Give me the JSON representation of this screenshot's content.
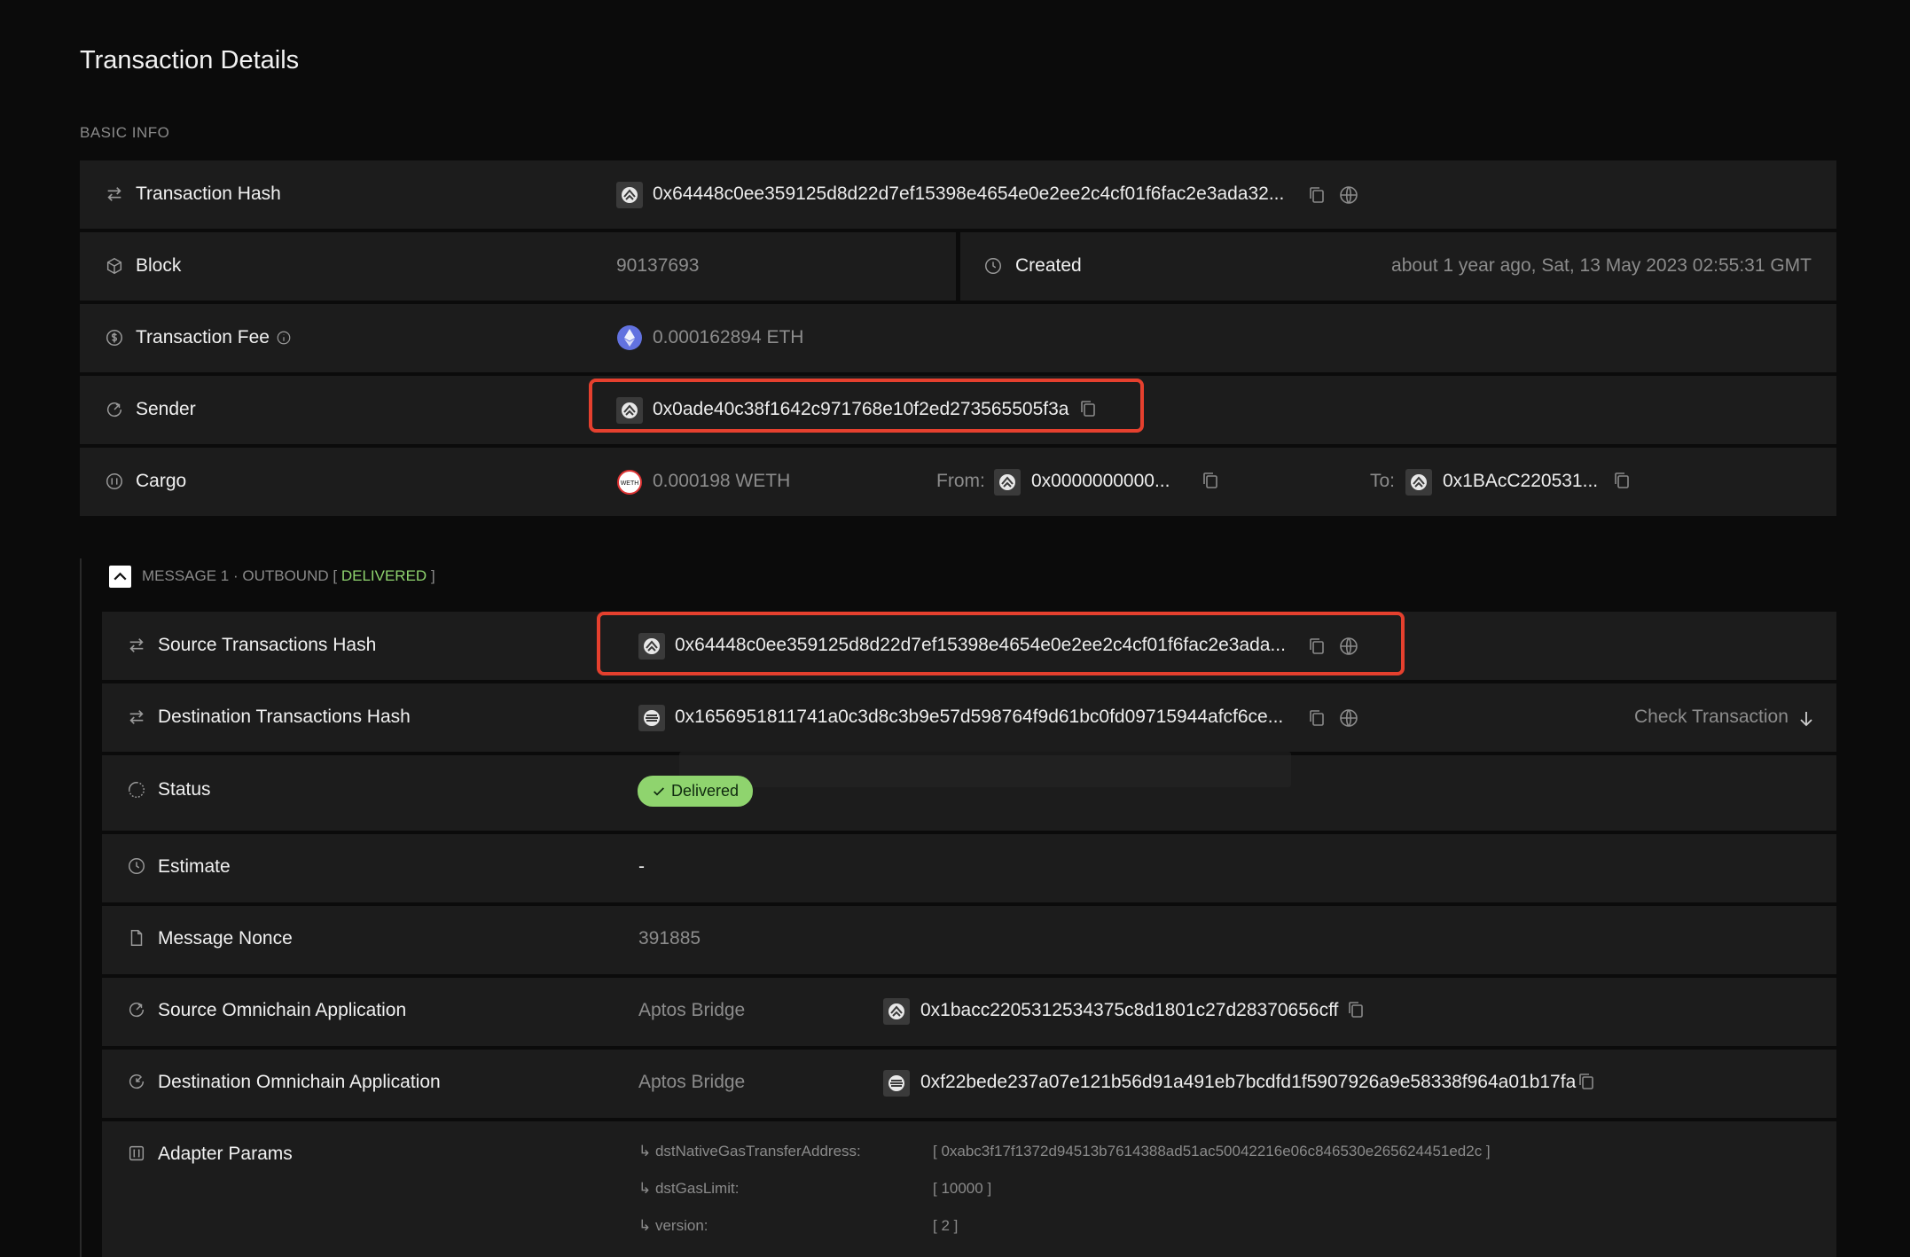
{
  "page_title": "Transaction Details",
  "section_basic": "BASIC INFO",
  "basic": {
    "tx_hash": {
      "label": "Transaction Hash",
      "value": "0x64448c0ee359125d8d22d7ef15398e4654e0e2ee2c4cf01f6fac2e3ada32..."
    },
    "block": {
      "label": "Block",
      "value": "90137693"
    },
    "created": {
      "label": "Created",
      "value": "about 1 year ago, Sat, 13 May 2023 02:55:31 GMT"
    },
    "fee": {
      "label": "Transaction Fee",
      "value": "0.000162894 ETH"
    },
    "sender": {
      "label": "Sender",
      "value": "0x0ade40c38f1642c971768e10f2ed273565505f3a"
    },
    "cargo": {
      "label": "Cargo",
      "value": "0.000198 WETH",
      "from_label": "From:",
      "from_value": "0x0000000000...",
      "to_label": "To:",
      "to_value": "0x1BAcC220531..."
    }
  },
  "message": {
    "header_prefix": "MESSAGE 1 · OUTBOUND [",
    "header_status": "DELIVERED",
    "header_suffix": "]",
    "status_color": "#8fd46e",
    "source_hash": {
      "label": "Source Transactions Hash",
      "value": "0x64448c0ee359125d8d22d7ef15398e4654e0e2ee2c4cf01f6fac2e3ada..."
    },
    "dest_hash": {
      "label": "Destination Transactions Hash",
      "value": "0x1656951811741a0c3d8c3b9e57d598764f9d61bc0fd09715944afcf6ce...",
      "action": "Check Transaction"
    },
    "status": {
      "label": "Status",
      "value": "Delivered"
    },
    "estimate": {
      "label": "Estimate",
      "value": "-"
    },
    "nonce": {
      "label": "Message Nonce",
      "value": "391885"
    },
    "source_app": {
      "label": "Source Omnichain Application",
      "name": "Aptos Bridge",
      "value": "0x1bacc2205312534375c8d1801c27d28370656cff"
    },
    "dest_app": {
      "label": "Destination Omnichain Application",
      "name": "Aptos Bridge",
      "value": "0xf22bede237a07e121b56d91a491eb7bcdfd1f5907926a9e58338f964a01b17fa"
    },
    "adapter": {
      "label": "Adapter Params",
      "params": [
        {
          "key": "dstNativeGasTransferAddress:",
          "value": "[ 0xabc3f17f1372d94513b7614388ad51ac50042216e06c846530e265624451ed2c ]"
        },
        {
          "key": "dstGasLimit:",
          "value": "[ 10000 ]"
        },
        {
          "key": "version:",
          "value": "[ 2 ]"
        }
      ]
    }
  },
  "colors": {
    "highlight": "#e5402e",
    "eth": "#6272e0",
    "badge": "#8fd46e"
  }
}
